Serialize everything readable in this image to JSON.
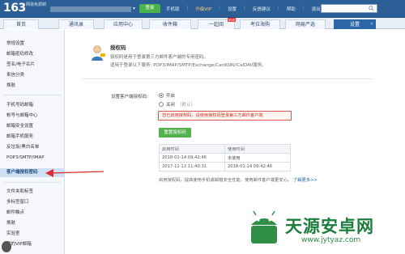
{
  "header": {
    "logo": "163",
    "logo_sub": "网易免费邮",
    "user_email": "••••••••••",
    "dropdown": "▾",
    "green_button": "登录",
    "links": [
      "手机版",
      "升级VIP",
      "设置",
      "反馈建议",
      "帮助",
      "退出"
    ],
    "search_placeholder": ""
  },
  "nav": {
    "tabs": [
      {
        "label": "首页",
        "active": false
      },
      {
        "label": "通讯录",
        "active": false
      },
      {
        "label": "应用中心",
        "active": false
      },
      {
        "label": "收件箱",
        "active": false
      },
      {
        "label": "一起阅",
        "active": false,
        "badge": "new"
      },
      {
        "label": "考拉海购",
        "active": false
      },
      {
        "label": "网易严选",
        "active": false
      },
      {
        "label": "设置",
        "active": true
      }
    ],
    "close_glyph": "×"
  },
  "sidebar": {
    "items": [
      {
        "label": "常规设置",
        "active": false
      },
      {
        "label": "邮箱密码修改",
        "active": false
      },
      {
        "label": "签名/电子名片",
        "active": false
      },
      {
        "label": "来信分类",
        "active": false
      },
      {
        "label": "换肤",
        "active": false
      },
      {
        "label": "手机号码邮箱",
        "active": false
      },
      {
        "label": "帐号与邮箱中心",
        "active": false
      },
      {
        "label": "邮箱安全设置",
        "active": false
      },
      {
        "label": "邮箱手机服务",
        "active": false
      },
      {
        "label": "反垃圾/黑白名单",
        "active": false
      },
      {
        "label": "POP3/SMTP/IMAP",
        "active": false
      },
      {
        "label": "客户端授权密码",
        "active": true
      },
      {
        "label": "文件夹和标签",
        "active": false
      },
      {
        "label": "多标签窗口",
        "active": false
      },
      {
        "label": "邮件触点",
        "active": false
      },
      {
        "label": "换肤",
        "active": false
      },
      {
        "label": "实验室",
        "active": false
      },
      {
        "label": "我的VIP邮箱",
        "active": false
      }
    ]
  },
  "main": {
    "title": "授权码",
    "desc1": "授权码是用于登录第三方邮件客户端的专用密码。",
    "desc2": "适用于登录以下服务: POP3/IMAP/SMTP/Exchange/CardDAV/CalDAV服务。",
    "setting_label": "设置客户端授权码:",
    "options": [
      {
        "label": "开启",
        "sub": "",
        "checked": true
      },
      {
        "label": "关闭",
        "sub": "（默认）",
        "checked": false
      }
    ],
    "notice": "您已启用授权码，请使用授权码登录第三方邮件客户端",
    "gen_button": "重置授权码",
    "table": {
      "headers": [
        "启用时间",
        "使用时间"
      ],
      "rows": [
        [
          "2018-01-14 09:42:46",
          "未使用"
        ],
        [
          "2017-11-12 11:40:31",
          "2018-01-14 09:42:46"
        ]
      ]
    },
    "bottom_note": "启用授权码，提高使用手机或邮箱安全性能，使用邮件客户端更安心。",
    "learn_more": "了解更多>>"
  },
  "watermark": {
    "brand": "天源安卓网",
    "url": "www.jytyaz.com"
  },
  "colors": {
    "header": "#2b5f95",
    "active_tab": "#2c66a7",
    "green": "#55b04e",
    "notice_red": "#cc3322",
    "arrow_red": "#e0282e"
  }
}
